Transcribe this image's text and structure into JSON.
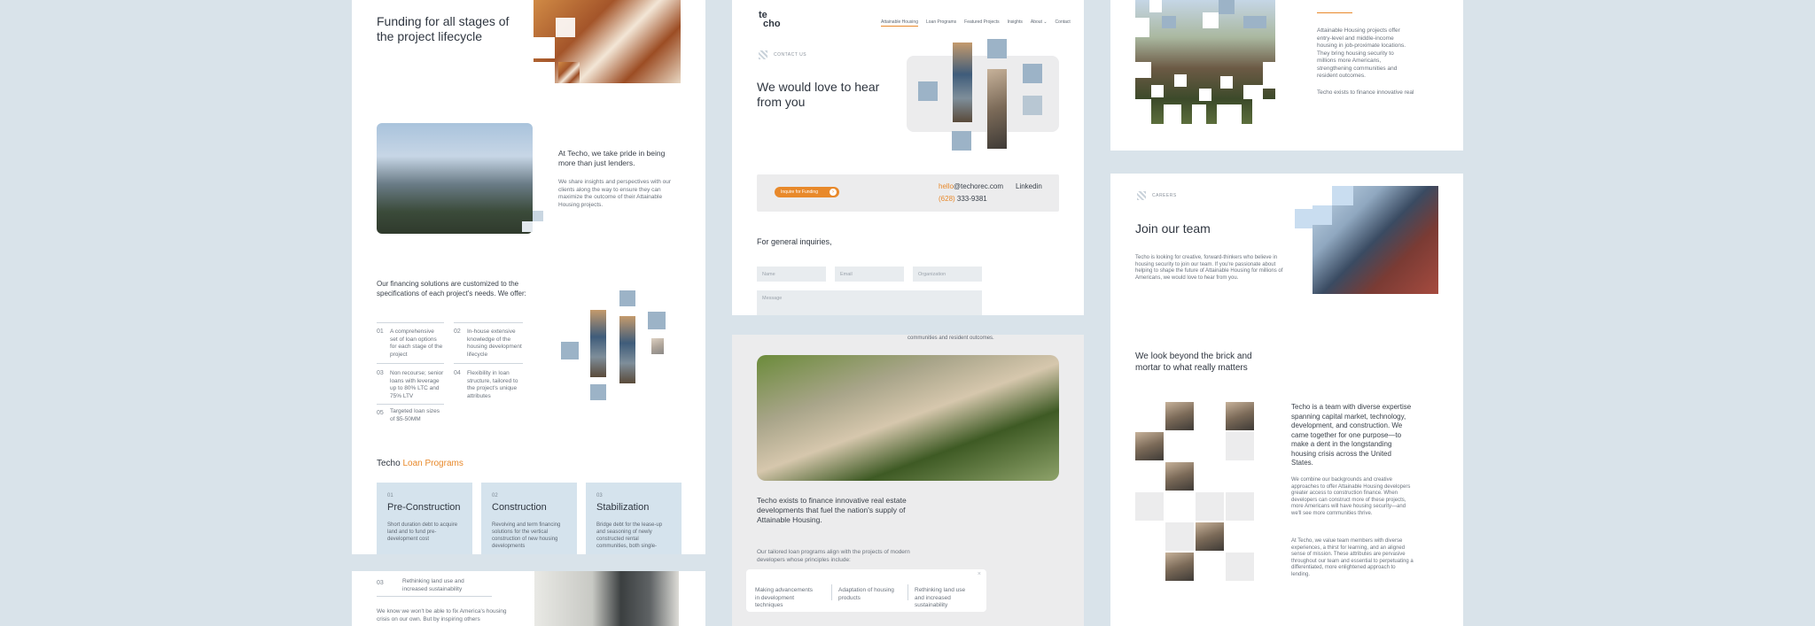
{
  "left_panel": {
    "heading": "Funding for all stages of the project lifecycle",
    "pride_title": "At Techo, we take pride in being more than just lenders.",
    "pride_body": "We share insights and perspectives with our clients along the way to ensure they can maximize the outcome of their Attainable Housing projects.",
    "offer_intro": "Our financing solutions are customized to the specifications of each project's needs. We offer:",
    "offers": [
      {
        "num": "01",
        "text": "A comprehensive set of loan options for each stage of the project"
      },
      {
        "num": "02",
        "text": "In-house extensive knowledge of the housing development lifecycle"
      },
      {
        "num": "03",
        "text": "Non recourse; senior loans with leverage up to 80% LTC and 75% LTV"
      },
      {
        "num": "04",
        "text": "Flexibility in loan structure, tailored to the project's unique attributes"
      },
      {
        "num": "05",
        "text": "Targeted loan sizes of $5-50MM"
      }
    ],
    "programs_prefix": "Techo ",
    "programs_highlight": "Loan Programs",
    "programs": [
      {
        "num": "01",
        "title": "Pre-Construction",
        "desc": "Short duration debt to acquire land and to fund pre-development cost"
      },
      {
        "num": "02",
        "title": "Construction",
        "desc": "Revolving and term financing solutions for the vertical construction of new housing developments"
      },
      {
        "num": "03",
        "title": "Stabilization",
        "desc": "Bridge debt for the lease-up and seasoning of newly constructed rental communities, both single-"
      }
    ]
  },
  "left_bottom": {
    "item_num": "03",
    "item_text": "Rethinking land use and increased sustainability",
    "body": "We know we won't be able to fix America's housing crisis on our own. But by inspiring others"
  },
  "contact": {
    "logo_line1": "te",
    "logo_line2": "cho",
    "nav": [
      "Attainable Housing",
      "Loan Programs",
      "Featured Projects",
      "Insights",
      "About",
      "Contact"
    ],
    "eyebrow": "CONTACT US",
    "heading": "We would love to hear from you",
    "cta": "Inquire for Funding",
    "email_prefix": "hello",
    "email_rest": "@techorec.com",
    "phone_code": "(628)",
    "phone_rest": " 333-9381",
    "linkedin": "Linkedin",
    "general": "For general inquiries,",
    "fields": [
      "Name",
      "Email",
      "Organization"
    ],
    "message_placeholder": "Message"
  },
  "middle_lower": {
    "top_text": "communities and resident outcomes.",
    "mission": "Techo exists to finance innovative real estate developments that fuel the nation's supply of Attainable Housing.",
    "tailored": "Our tailored loan programs align with the projects of modern developers whose principles include:",
    "principles": [
      "Making advancements in development techniques",
      "Adaptation of housing products",
      "Rethinking land use and increased sustainability"
    ]
  },
  "right_top": {
    "body": "Attainable Housing projects offer entry-level and middle-income housing in job-proximate locations. They bring housing security to millions more Americans, strengthening communities and resident outcomes.",
    "body2": "Techo exists to finance innovative real"
  },
  "careers": {
    "eyebrow": "CAREERS",
    "heading": "Join our team",
    "intro": "Techo is looking for creative, forward-thinkers who believe in housing security to join our team. If you're passionate about helping to shape the future of Attainable Housing for millions of Americans, we would love to hear from you.",
    "look_beyond": "We look beyond the brick and mortar to what really matters",
    "team_lead": "Techo is a team with diverse expertise spanning capital market, technology, development, and construction. We came together for one purpose—to make a dent in the longstanding housing crisis across the United States.",
    "team_body1": "We combine our backgrounds and creative approaches to offer Attainable Housing developers greater access to construction finance. When developers can construct more of these projects, more Americans will have housing security—and we'll see more communities thrive.",
    "team_body2": "At Techo, we value team members with diverse experiences, a thirst for learning, and an aligned sense of mission. These attributes are pervasive throughout our team and essential to perpetuating a differentiated, more enlightened approach to lending."
  },
  "colors": {
    "accent": "#e8892b",
    "background": "#d9e3ea",
    "block": "#9cb3c7",
    "card": "#d5e3ed"
  }
}
